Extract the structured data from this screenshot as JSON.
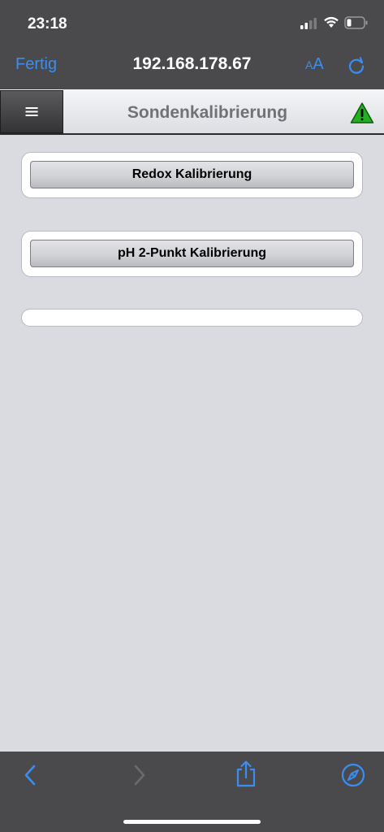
{
  "status_bar": {
    "time": "23:18"
  },
  "browser": {
    "done_label": "Fertig",
    "url": "192.168.178.67",
    "text_size_small": "A",
    "text_size_big": "A",
    "accent_color": "#3a8ef2"
  },
  "page": {
    "menu_glyph": "≡",
    "title": "Sondenkalibrierung",
    "warning_color": "#22b022"
  },
  "calibration": {
    "buttons": [
      {
        "label": "Redox Kalibrierung"
      },
      {
        "label": "pH 2-Punkt Kalibrierung"
      }
    ]
  },
  "toolbar": {
    "icons": [
      "back-icon",
      "forward-icon",
      "share-icon",
      "compass-icon"
    ]
  }
}
